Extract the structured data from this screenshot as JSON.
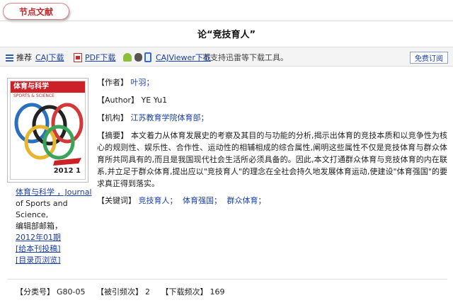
{
  "tab": {
    "label": "节点文献"
  },
  "title": "论“竞技育人”",
  "toolbar": {
    "recommend_label": "推荐",
    "caj_download": "CAJ下载",
    "pdf_download": "PDF下载",
    "cajviewer_download": "CAJViewer下载",
    "note": "不支持迅雷等下载工具。",
    "subscribe": "免费订阅"
  },
  "cover": {
    "journal_title": "体育与科学",
    "english_title": "SPORTS & SCIENCE",
    "year_issue": "2012 1"
  },
  "journal": {
    "lines": [
      "体育与科学 ，Journal",
      "of Sports and",
      "Science,",
      "编辑部邮箱，",
      "2012年01期"
    ],
    "submit_link": "[给本刊投稿]",
    "browse_link": "[目录页浏览]"
  },
  "meta": {
    "author_label": "【作者】",
    "author": "叶羽；",
    "author_en_label": "【Author】",
    "author_en": "YE Yu1",
    "org_label": "【机构】",
    "org": "江苏教育学院体育部；",
    "abstract_label": "【摘要】",
    "abstract": "本文着力从体育发展史的考察及其目的与功能的分析,揭示出体育的竞技本质和以竞争性为核心的规则性、娱乐性、合作性、运动性的相辅相成的综合属性,阐明这些属性不仅是竞技体育与群众体育所共同具有的,而且是我国现代社会生活所必须具备的。因此,本文打通群众体育与竞技体育的内在联系,并立足于群众体育,提出应以\"竞技育人\"的理念在全社会持久地发展体育运动,使建设\"体育强国\"的要求真正得到落实。",
    "keywords_label": "【关键词】",
    "keywords": [
      "竞技育人；",
      "体育强国；",
      "群众体育；"
    ]
  },
  "bottom": {
    "class_label": "【分类号】",
    "class_value": "G80-05",
    "cited_label": "【被引频次】",
    "cited_value": "2",
    "download_label": "【下载频次】",
    "download_value": "169"
  },
  "colors": {
    "accent_red": "#c0282d",
    "link_blue": "#1a3fa8"
  }
}
